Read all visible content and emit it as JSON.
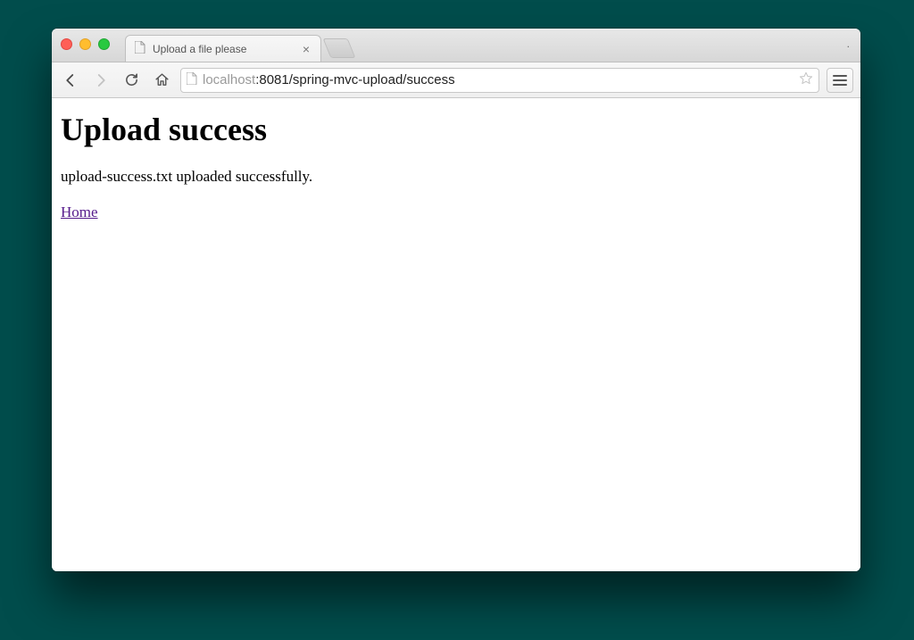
{
  "tab": {
    "title": "Upload a file please"
  },
  "address": {
    "host_faded": "localhost",
    "rest": ":8081/spring-mvc-upload/success"
  },
  "page": {
    "heading": "Upload success",
    "message": "upload-success.txt uploaded successfully.",
    "home_link": "Home"
  }
}
